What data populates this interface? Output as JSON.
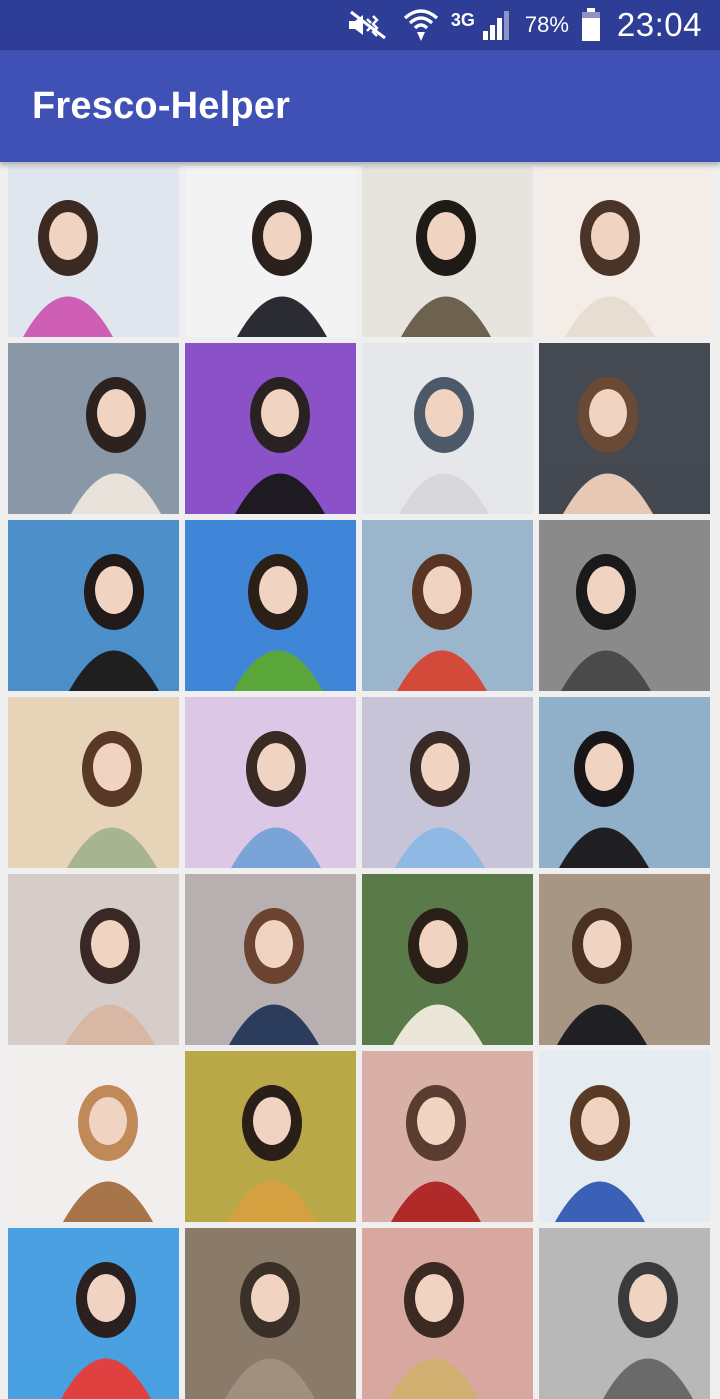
{
  "status_bar": {
    "network": "3G",
    "battery": "78%",
    "time": "23:04",
    "icons": [
      "mute-icon",
      "wifi-icon",
      "signal-icon",
      "battery-icon"
    ],
    "icon_color": "#ffffff"
  },
  "app_bar": {
    "title": "Fresco-Helper",
    "color": "#3f51b5",
    "status_color": "#2e3d96"
  },
  "gallery": {
    "columns": 4,
    "photos": [
      {
        "bg": "#dfe6ee",
        "fg": "#cf5fb4",
        "hair": "#3a2a22"
      },
      {
        "bg": "#f3f3f4",
        "fg": "#2b2b33",
        "hair": "#2a201c"
      },
      {
        "bg": "#e7e4df",
        "fg": "#6d6150",
        "hair": "#1f1a16"
      },
      {
        "bg": "#f4ece6",
        "fg": "#e8ddd3",
        "hair": "#4a3428"
      },
      {
        "bg": "#8a97a6",
        "fg": "#e8e2da",
        "hair": "#2c2220"
      },
      {
        "bg": "#8b52c8",
        "fg": "#1e1a22",
        "hair": "#2a2222"
      },
      {
        "bg": "#e5e7ea",
        "fg": "#d8d8dc",
        "hair": "#4b5968"
      },
      {
        "bg": "#454a52",
        "fg": "#e7c8b4",
        "hair": "#6a4a34"
      },
      {
        "bg": "#4d8fc8",
        "fg": "#1f1f1f",
        "hair": "#221a18"
      },
      {
        "bg": "#3f86d8",
        "fg": "#5aa63a",
        "hair": "#2a2018"
      },
      {
        "bg": "#9bb6cc",
        "fg": "#d44a3a",
        "hair": "#5a3422"
      },
      {
        "bg": "#8a8a8a",
        "fg": "#4a4a4a",
        "hair": "#1a1a1a"
      },
      {
        "bg": "#e7d4b8",
        "fg": "#a7b490",
        "hair": "#5a3826"
      },
      {
        "bg": "#dcc8e6",
        "fg": "#7aa4d8",
        "hair": "#3a2a24"
      },
      {
        "bg": "#c8c4d8",
        "fg": "#8fb8e4",
        "hair": "#3a2a26"
      },
      {
        "bg": "#8fb0c8",
        "fg": "#1f1f22",
        "hair": "#1a1618"
      },
      {
        "bg": "#d6cdca",
        "fg": "#d8b8a4",
        "hair": "#3a2824"
      },
      {
        "bg": "#b8b0b0",
        "fg": "#2c3c5c",
        "hair": "#6a4430"
      },
      {
        "bg": "#5a7a4a",
        "fg": "#ece6d8",
        "hair": "#2a2018"
      },
      {
        "bg": "#a89684",
        "fg": "#1f1f24",
        "hair": "#4a3020"
      },
      {
        "bg": "#f2eeee",
        "fg": "#a8744a",
        "hair": "#c08a58"
      },
      {
        "bg": "#b8a848",
        "fg": "#d4a040",
        "hair": "#2a1e18"
      },
      {
        "bg": "#d8b0a8",
        "fg": "#b02a2a",
        "hair": "#5a3c30"
      },
      {
        "bg": "#e4ecf2",
        "fg": "#3a60b8",
        "hair": "#5a3a24"
      },
      {
        "bg": "#4aa0e0",
        "fg": "#e04040",
        "hair": "#2a2020"
      },
      {
        "bg": "#8a7a6a",
        "fg": "#a09080",
        "hair": "#3a3028"
      },
      {
        "bg": "#d8a8a0",
        "fg": "#d0b070",
        "hair": "#3a2a22"
      },
      {
        "bg": "#b8b8b8",
        "fg": "#6a6a6a",
        "hair": "#3a3a3a"
      }
    ]
  }
}
